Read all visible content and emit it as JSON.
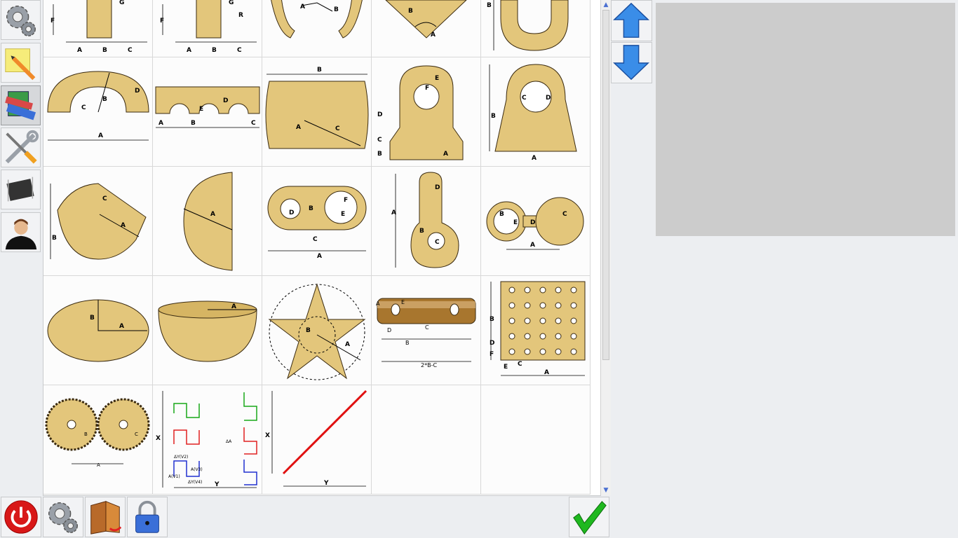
{
  "sidebar": {
    "items": [
      {
        "name": "settings-gears-icon"
      },
      {
        "name": "note-pencil-icon"
      },
      {
        "name": "books-library-icon"
      },
      {
        "name": "tools-wrench-screwdriver-icon"
      },
      {
        "name": "chip-icon"
      },
      {
        "name": "user-avatar-icon"
      }
    ],
    "active_index": 2
  },
  "shape_library": {
    "row0": {
      "c0": [
        "F",
        "A",
        "B",
        "C",
        "G"
      ],
      "c1": [
        "F",
        "A",
        "B",
        "C",
        "G",
        "R"
      ],
      "c2": [
        "A",
        "B"
      ],
      "c3": [
        "B",
        "A"
      ],
      "c4": [
        "B"
      ]
    },
    "row1": {
      "c0": [
        "D",
        "B",
        "C",
        "A"
      ],
      "c1": [
        "D",
        "E",
        "A",
        "B",
        "C"
      ],
      "c2": [
        "B",
        "A",
        "C"
      ],
      "c3": [
        "F",
        "E",
        "D",
        "C",
        "B",
        "A"
      ],
      "c4": [
        "C",
        "D",
        "B",
        "A"
      ]
    },
    "row2": {
      "c0": [
        "C",
        "A",
        "B"
      ],
      "c1": [
        "A"
      ],
      "c2": [
        "D",
        "B",
        "F",
        "E",
        "C",
        "A"
      ],
      "c3": [
        "D",
        "A",
        "B",
        "C"
      ],
      "c4": [
        "B",
        "E",
        "D",
        "C",
        "A"
      ]
    },
    "row3": {
      "c0": [
        "B",
        "A"
      ],
      "c1": [
        "A"
      ],
      "c2": [
        "B",
        "A"
      ],
      "c3": [
        "A",
        "E",
        "D",
        "C",
        "B",
        "2*B-C"
      ],
      "c4": [
        "B",
        "D",
        "F",
        "E",
        "C",
        "A"
      ]
    },
    "row4": {
      "c0": [
        "B",
        "C",
        "A"
      ],
      "c1": [
        "X",
        "ΔY(V2)",
        "A(V1)",
        "A(V3)",
        "ΔY(V4)",
        "ΔA",
        "Y"
      ],
      "c2": [
        "X",
        "Y"
      ]
    }
  },
  "nav": {
    "up": "arrow-up-icon",
    "down": "arrow-down-icon"
  },
  "bottom": {
    "power": "power-icon",
    "settings": "settings-gears-icon",
    "book": "book-exit-icon",
    "lock": "lock-icon",
    "confirm": "checkmark-icon"
  },
  "colors": {
    "shape_fill": "#e3c67b",
    "shape_stroke": "#3a2a10",
    "arrow_blue": "#3a8de8",
    "confirm_green": "#1fb81f",
    "power_red": "#d81818",
    "line_red": "#e01010"
  }
}
